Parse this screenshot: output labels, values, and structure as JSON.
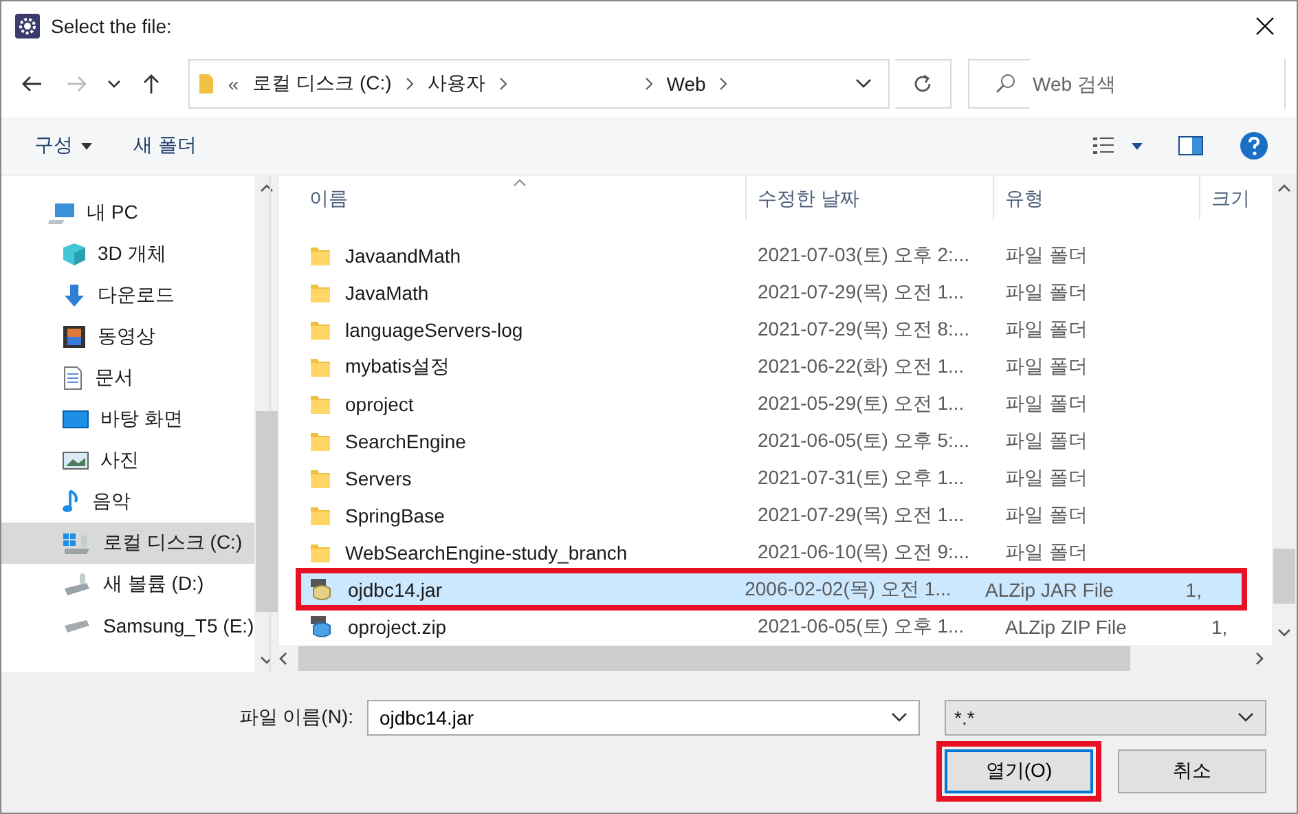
{
  "window": {
    "title": "Select the file:"
  },
  "address": {
    "segments": [
      {
        "label": "«",
        "kind": "overflow"
      },
      {
        "label": "로컬 디스크 (C:)",
        "kind": "folder"
      },
      {
        "label": "사용자",
        "kind": "folder"
      },
      {
        "kind": "hidden"
      },
      {
        "label": "Web",
        "kind": "folder"
      }
    ]
  },
  "search": {
    "placeholder": "Web 검색"
  },
  "toolbar": {
    "organize": "구성",
    "new_folder": "새 폴더"
  },
  "sidebar": {
    "items": [
      {
        "label": "내 PC",
        "selected": false,
        "children": [
          {
            "label": "3D 개체",
            "selected": false
          },
          {
            "label": "다운로드",
            "selected": false
          },
          {
            "label": "동영상",
            "selected": false
          },
          {
            "label": "문서",
            "selected": false
          },
          {
            "label": "바탕 화면",
            "selected": false
          },
          {
            "label": "사진",
            "selected": false
          },
          {
            "label": "음악",
            "selected": false
          },
          {
            "label": "로컬 디스크 (C:)",
            "selected": true
          },
          {
            "label": "새 볼륨 (D:)",
            "selected": false
          },
          {
            "label": "Samsung_T5 (E:)",
            "selected": false
          }
        ]
      }
    ]
  },
  "table": {
    "columns": [
      "이름",
      "수정한 날짜",
      "유형",
      "크기"
    ],
    "rows": [
      {
        "name": "JavaandMath",
        "date": "2021-07-03(토) 오후 2:...",
        "type": "파일 폴더",
        "size": "",
        "kind": "folder",
        "selected": false,
        "highlighted": false
      },
      {
        "name": "JavaMath",
        "date": "2021-07-29(목) 오전 1...",
        "type": "파일 폴더",
        "size": "",
        "kind": "folder",
        "selected": false,
        "highlighted": false
      },
      {
        "name": "languageServers-log",
        "date": "2021-07-29(목) 오전 8:...",
        "type": "파일 폴더",
        "size": "",
        "kind": "folder",
        "selected": false,
        "highlighted": false
      },
      {
        "name": "mybatis설정",
        "date": "2021-06-22(화) 오전 1...",
        "type": "파일 폴더",
        "size": "",
        "kind": "folder",
        "selected": false,
        "highlighted": false
      },
      {
        "name": "oproject",
        "date": "2021-05-29(토) 오전 1...",
        "type": "파일 폴더",
        "size": "",
        "kind": "folder",
        "selected": false,
        "highlighted": false
      },
      {
        "name": "SearchEngine",
        "date": "2021-06-05(토) 오후 5:...",
        "type": "파일 폴더",
        "size": "",
        "kind": "folder",
        "selected": false,
        "highlighted": false
      },
      {
        "name": "Servers",
        "date": "2021-07-31(토) 오후 1...",
        "type": "파일 폴더",
        "size": "",
        "kind": "folder",
        "selected": false,
        "highlighted": false
      },
      {
        "name": "SpringBase",
        "date": "2021-07-29(목) 오전 1...",
        "type": "파일 폴더",
        "size": "",
        "kind": "folder",
        "selected": false,
        "highlighted": false
      },
      {
        "name": "WebSearchEngine-study_branch",
        "date": "2021-06-10(목) 오전 9:...",
        "type": "파일 폴더",
        "size": "",
        "kind": "folder",
        "selected": false,
        "highlighted": false
      },
      {
        "name": "ojdbc14.jar",
        "date": "2006-02-02(목) 오전 1...",
        "type": "ALZip JAR File",
        "size": "1,",
        "kind": "jar",
        "selected": true,
        "highlighted": true
      },
      {
        "name": "oproject.zip",
        "date": "2021-06-05(토) 오후 1...",
        "type": "ALZip ZIP File",
        "size": "1,",
        "kind": "zip",
        "selected": false,
        "highlighted": false
      }
    ]
  },
  "filename": {
    "label": "파일 이름(N):",
    "value": "ojdbc14.jar"
  },
  "filter": {
    "value": "*.*"
  },
  "buttons": [
    {
      "label": "열기(O)",
      "kind": "primary",
      "highlighted": true
    },
    {
      "label": "취소",
      "kind": "normal",
      "highlighted": false
    }
  ]
}
